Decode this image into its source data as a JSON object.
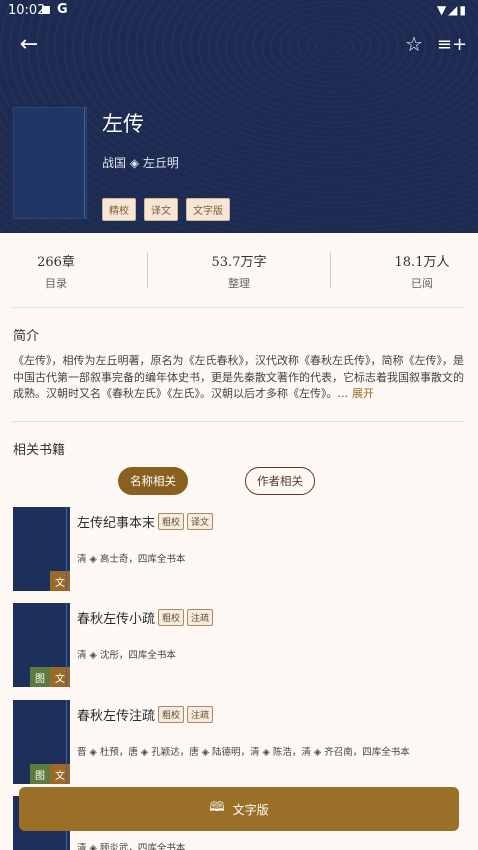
{
  "status": {
    "time": "10:02",
    "g": "G",
    "right": "▼◢▮"
  },
  "appbar": {
    "back": "←",
    "star": "☆",
    "listadd": "≡+"
  },
  "book": {
    "title": "左传",
    "author": "战国 ◈ 左丘明",
    "tags": [
      "精校",
      "译文",
      "文字版"
    ]
  },
  "stats": [
    {
      "value": "266章",
      "label": "目录"
    },
    {
      "value": "53.7万字",
      "label": "整理"
    },
    {
      "value": "18.1万人",
      "label": "已阅"
    }
  ],
  "intro": {
    "title": "简介",
    "text": "《左传》，相传为左丘明著，原名为《左氏春秋》，汉代改称《春秋左氏传》，简称《左传》，是中国古代第一部叙事完备的编年体史书，更是先秦散文著作的代表，它标志着我国叙事散文的成熟。汉朝时又名《春秋左氏》《左氏》。汉朝以后才多称《左传》。...",
    "more": "展开"
  },
  "related": {
    "title": "相关书籍",
    "tabs": [
      "名称相关",
      "作者相关"
    ],
    "items": [
      {
        "title": "左传纪事本末",
        "tags": [
          "粗校",
          "译文"
        ],
        "author": "清 ◈ 高士奇，四库全书本",
        "badges": [
          "文"
        ]
      },
      {
        "title": "春秋左传小疏",
        "tags": [
          "粗校",
          "注疏"
        ],
        "author": "清 ◈ 沈彤，四库全书本",
        "badges": [
          "图",
          "文"
        ]
      },
      {
        "title": "春秋左传注疏",
        "tags": [
          "粗校",
          "注疏"
        ],
        "author": "晋 ◈ 杜预，唐 ◈ 孔颖达，唐 ◈ 陆德明，清 ◈ 陈浩，清 ◈ 齐召南，四库全书本",
        "badges": [
          "图",
          "文"
        ]
      },
      {
        "title": "",
        "tags": [],
        "author": "清 ◈ 顾炎武，四库全书本",
        "badges": []
      }
    ]
  },
  "bottom": {
    "icon": "🕮",
    "label": "文字版"
  }
}
